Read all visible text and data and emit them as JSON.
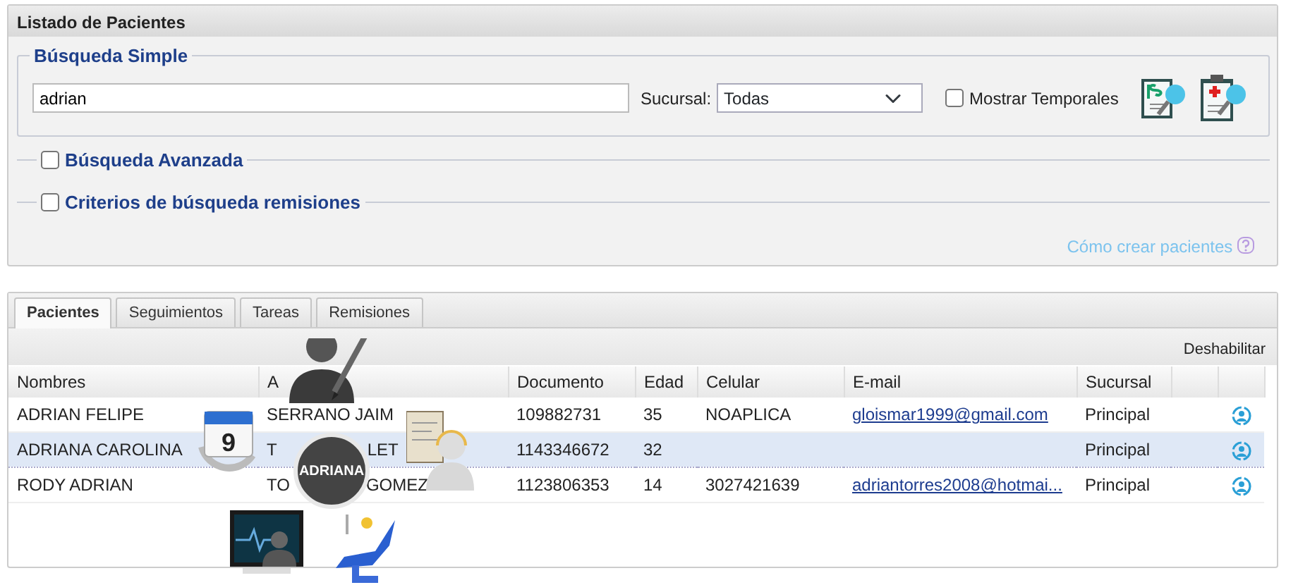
{
  "panel": {
    "title": "Listado de Pacientes"
  },
  "simple_search": {
    "legend": "Búsqueda Simple",
    "query": "adrian",
    "branch_label": "Sucursal:",
    "branch_value": "Todas",
    "show_temp": {
      "label": "Mostrar Temporales",
      "checked": false
    }
  },
  "sections": [
    {
      "label": "Búsqueda Avanzada",
      "checked": false
    },
    {
      "label": "Criterios de búsqueda remisiones",
      "checked": false
    }
  ],
  "help_link": "Cómo crear pacientes",
  "tabs": [
    {
      "label": "Pacientes",
      "selected": true
    },
    {
      "label": "Seguimientos",
      "selected": false
    },
    {
      "label": "Tareas",
      "selected": false
    },
    {
      "label": "Remisiones",
      "selected": false
    }
  ],
  "toolbar": {
    "action": "Deshabilitar"
  },
  "table": {
    "columns": [
      "Nombres",
      "A",
      "Documento",
      "Edad",
      "Celular",
      "E-mail",
      "Sucursal"
    ],
    "rows": [
      {
        "nombres": "ADRIAN FELIPE",
        "apellidos": [
          "SERRANO JAIM"
        ],
        "documento": "109882731",
        "edad": "35",
        "celular": "NOAPLICA",
        "email": "gloismar1999@gmail.com",
        "sucursal": "Principal",
        "selected": false
      },
      {
        "nombres": "ADRIANA CAROLINA",
        "apellidos": [
          "T",
          "LET"
        ],
        "documento": "1143346672",
        "edad": "32",
        "celular": "",
        "email": "",
        "sucursal": "Principal",
        "selected": true
      },
      {
        "nombres": "RODY ADRIAN",
        "apellidos": [
          "TO",
          "GOMEZ"
        ],
        "documento": "1123806353",
        "edad": "14",
        "celular": "3027421639",
        "email": "adriantorres2008@hotmai...",
        "sucursal": "Principal",
        "selected": false
      }
    ]
  },
  "radial_menu": {
    "center_label": "ADRIANA",
    "calendar_day": "9"
  }
}
